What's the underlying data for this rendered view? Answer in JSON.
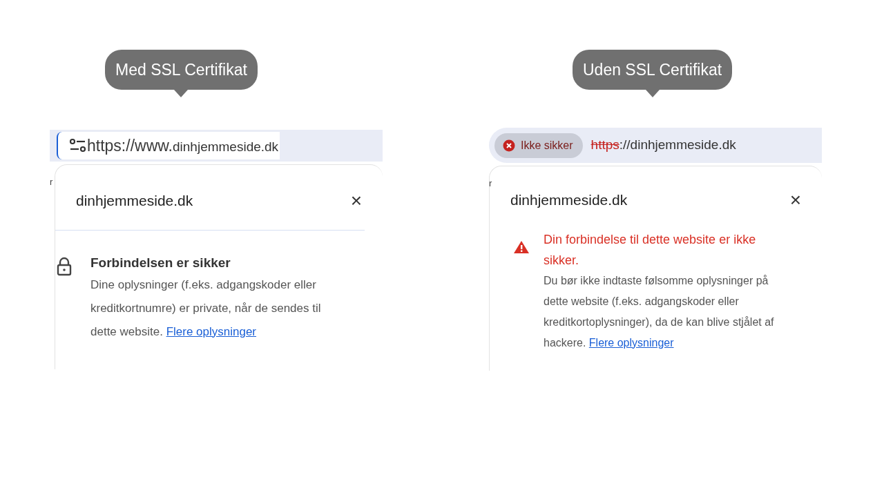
{
  "panels": [
    {
      "kind": "secure",
      "callout": "Med SSL Certifikat",
      "edge_fragment": "r",
      "address_bar": {
        "segments": [
          {
            "text": "https://www.",
            "kind": "highlighted"
          },
          {
            "text": "dinhjemmeside.dk",
            "kind": "plain"
          }
        ]
      },
      "popup": {
        "title": "dinhjemmeside.dk",
        "close": "×",
        "heading": "Forbindelsen er sikker",
        "body": "Dine oplysninger (f.eks. adgangskoder eller kreditkortnumre) er private, når de sendes til dette website.",
        "link": "Flere oplysninger"
      }
    },
    {
      "kind": "insecure",
      "callout": "Uden SSL Certifikat",
      "edge_fragment": "r",
      "address_bar": {
        "badge": "Ikke sikker",
        "segments": [
          {
            "text": "https",
            "kind": "struck"
          },
          {
            "text": "://dinhjemmeside.dk",
            "kind": "plain"
          }
        ]
      },
      "popup": {
        "title": "dinhjemmeside.dk",
        "close": "×",
        "heading": "Din forbindelse til dette website er ikke sikker.",
        "body": "Du bør ikke indtaste følsomme oplysninger på dette website (f.eks. adgangskoder eller kreditkortoplysninger), da de kan blive stjålet af hackere.",
        "link": "Flere oplysninger"
      }
    }
  ]
}
